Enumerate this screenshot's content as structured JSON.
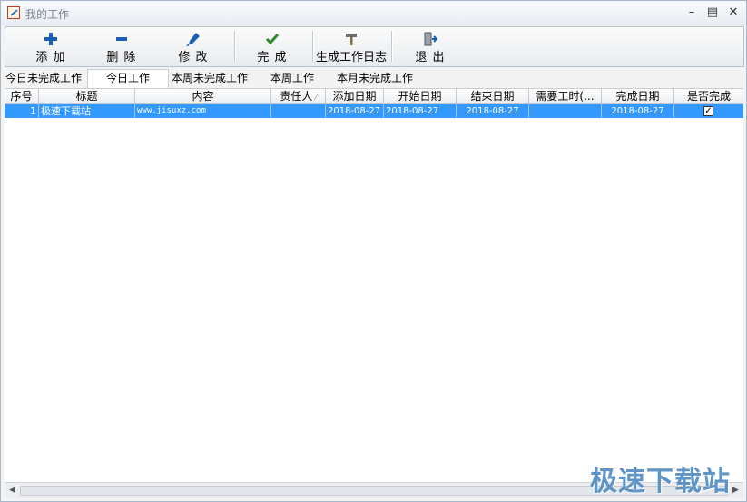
{
  "window": {
    "title": "我的工作"
  },
  "toolbar": [
    {
      "id": "add",
      "label": "添 加",
      "icon": "plus-icon"
    },
    {
      "id": "delete",
      "label": "删 除",
      "icon": "minus-icon"
    },
    {
      "id": "edit",
      "label": "修 改",
      "icon": "pen-icon"
    },
    {
      "id": "complete",
      "label": "完 成",
      "icon": "checkmark-icon"
    },
    {
      "id": "log",
      "label": "生成工作日志",
      "icon": "hammer-icon"
    },
    {
      "id": "exit",
      "label": "退 出",
      "icon": "exit-door-icon"
    }
  ],
  "tabs": [
    {
      "label": "今日未完成工作",
      "active": false
    },
    {
      "label": "今日工作",
      "active": true
    },
    {
      "label": "本周未完成工作",
      "active": false
    },
    {
      "label": "本周工作",
      "active": false
    },
    {
      "label": "本月未完成工作",
      "active": false
    }
  ],
  "columns": [
    "序号",
    "标题",
    "内容",
    "责任人",
    "添加日期",
    "开始日期",
    "结束日期",
    "需要工时(...",
    "完成日期",
    "是否完成"
  ],
  "rows": [
    {
      "no": "1",
      "title": "极速下载站",
      "content": "www.jisuxz.com",
      "owner": "",
      "added": "2018-08-27",
      "start": "2018-08-27",
      "end": "2018-08-27",
      "hours": "",
      "done_date": "2018-08-27",
      "done": true
    }
  ],
  "watermark": "极速下载站",
  "colors": {
    "selection": "#3399ff",
    "icon_blue": "#1a5fb4",
    "icon_green": "#2e8b2e",
    "watermark": "#5f94c6"
  }
}
